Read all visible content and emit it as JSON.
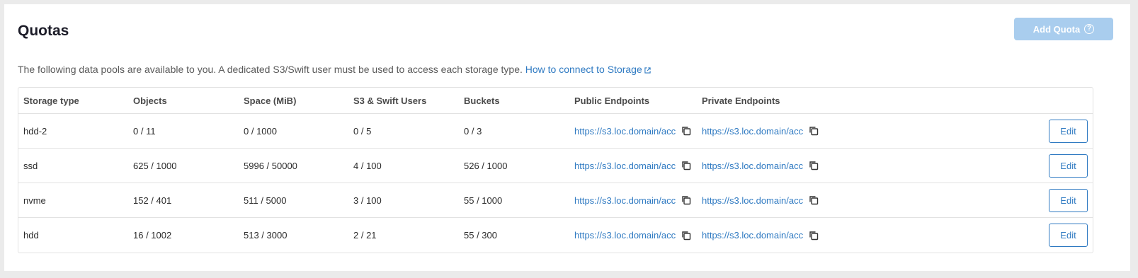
{
  "page": {
    "title": "Quotas",
    "add_button_label": "Add Quota",
    "help_icon": "?",
    "intro_text": "The following data pools are available to you. A dedicated S3/Swift user must be used to access each storage type. ",
    "intro_link_label": "How to connect to Storage"
  },
  "table": {
    "headers": [
      "Storage type",
      "Objects",
      "Space (MiB)",
      "S3 & Swift Users",
      "Buckets",
      "Public Endpoints",
      "Private Endpoints"
    ],
    "edit_label": "Edit",
    "rows": [
      {
        "type": "hdd-2",
        "objects": "0 / 11",
        "space": "0 / 1000",
        "users": "0 / 5",
        "buckets": "0 / 3",
        "public": "https://s3.loc.domain/acc",
        "private": "https://s3.loc.domain/acc"
      },
      {
        "type": "ssd",
        "objects": "625 / 1000",
        "space": "5996 / 50000",
        "users": "4 / 100",
        "buckets": "526 / 1000",
        "public": "https://s3.loc.domain/acc",
        "private": "https://s3.loc.domain/acc"
      },
      {
        "type": "nvme",
        "objects": "152 / 401",
        "space": "511 / 5000",
        "users": "3 / 100",
        "buckets": "55 / 1000",
        "public": "https://s3.loc.domain/acc",
        "private": "https://s3.loc.domain/acc"
      },
      {
        "type": "hdd",
        "objects": "16 / 1002",
        "space": "513 / 3000",
        "users": "2 / 21",
        "buckets": "55 / 300",
        "public": "https://s3.loc.domain/acc",
        "private": "https://s3.loc.domain/acc"
      }
    ]
  },
  "colors": {
    "accent": "#2f7ac2",
    "disabled_button": "#a9cdee",
    "border": "#e2e2e2"
  }
}
